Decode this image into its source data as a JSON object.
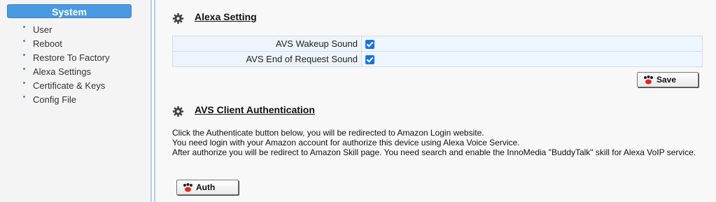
{
  "sidebar": {
    "header": "System",
    "items": [
      {
        "label": "User"
      },
      {
        "label": "Reboot"
      },
      {
        "label": "Restore To Factory"
      },
      {
        "label": "Alexa Settings"
      },
      {
        "label": "Certificate & Keys"
      },
      {
        "label": "Config File"
      }
    ]
  },
  "alexa_setting": {
    "title": "Alexa Setting",
    "rows": [
      {
        "label": "AVS Wakeup Sound",
        "checked": true
      },
      {
        "label": "AVS End of Request Sound",
        "checked": true
      }
    ],
    "save_label": "Save"
  },
  "avs_auth": {
    "title": "AVS Client Authentication",
    "lines": [
      "Click the Authenticate button below, you will be redirected to Amazon Login website.",
      "You need login with your Amazon account for authorize this device using Alexa Voice Service.",
      "After authorize you will be redirect to Amazon Skill page. You need search and enable the InnoMedia \"BuddyTalk\" skill for Alexa VoIP service."
    ],
    "auth_label": "Auth"
  },
  "colors": {
    "accent": "#4a9ae0",
    "checkbox": "#1a73e8"
  }
}
